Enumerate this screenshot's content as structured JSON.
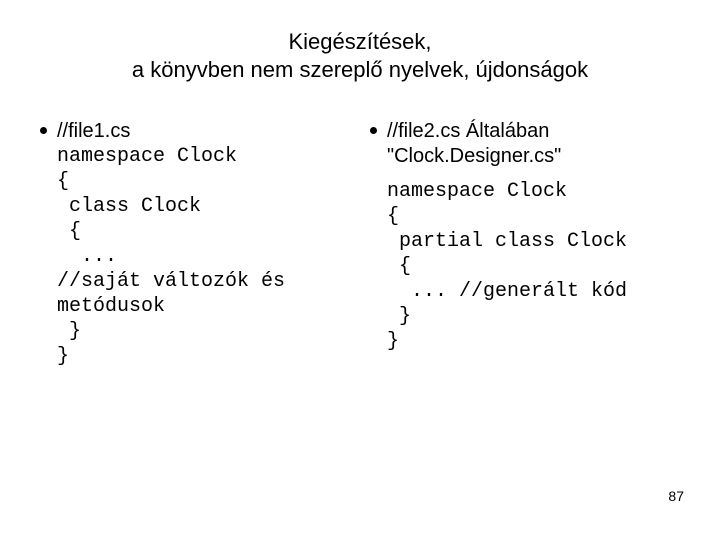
{
  "title_line1": "Kiegészítések,",
  "title_line2": "a könyvben nem szereplő nyelvek, újdonságok",
  "left": {
    "lead": "//file1.cs",
    "code": "namespace Clock\n{\n class Clock\n {\n  ...\n//saját változók és\nmetódusok\n }\n}"
  },
  "right": {
    "lead": "//file2.cs Általában \"Clock.Designer.cs\"",
    "code": "namespace Clock\n{\n partial class Clock\n {\n  ... //generált kód\n }\n}"
  },
  "page_number": "87"
}
